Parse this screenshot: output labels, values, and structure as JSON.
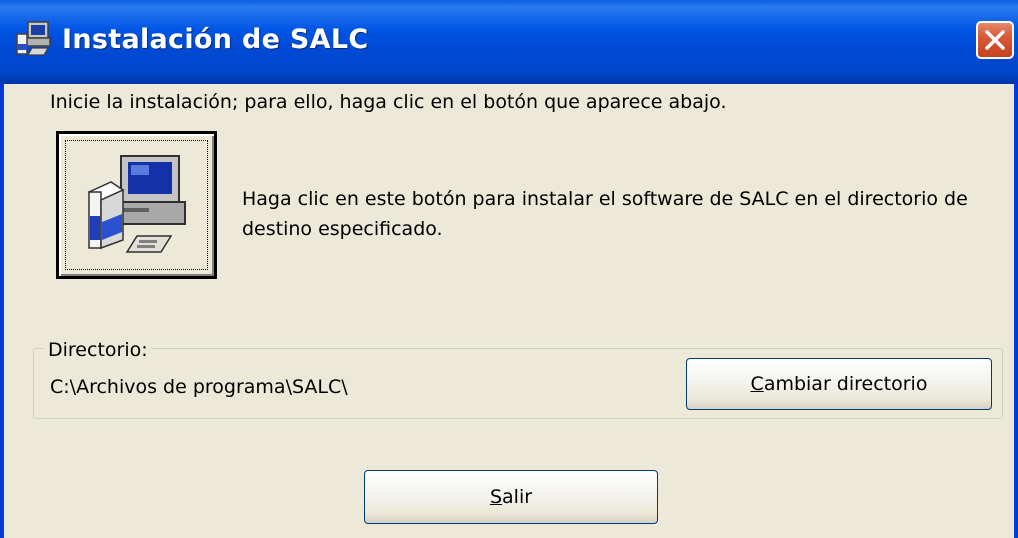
{
  "window": {
    "title": "Instalación de SALC",
    "close_icon": "close-icon",
    "title_icon": "setup-computer-icon"
  },
  "main": {
    "intro_text": "Inicie la instalación; para ello, haga clic en el botón que aparece abajo.",
    "install_button_icon": "setup-computer-icon",
    "install_description": "Haga clic en este botón para instalar el software de SALC en el directorio de destino especificado."
  },
  "directory": {
    "group_label": "Directorio:",
    "path": "C:\\Archivos de programa\\SALC\\",
    "change_button": {
      "mnemonic": "C",
      "rest": "ambiar directorio"
    }
  },
  "footer": {
    "exit_button": {
      "mnemonic": "S",
      "rest": "alir"
    }
  },
  "colors": {
    "titlebar": "#0055e5",
    "dialog_bg": "#ece9d8",
    "close_button": "#d9583a"
  }
}
